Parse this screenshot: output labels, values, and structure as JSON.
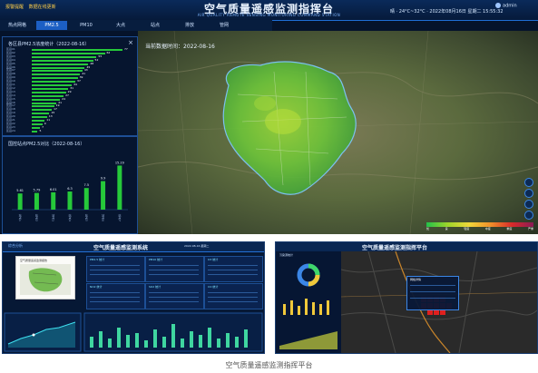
{
  "main": {
    "title": "空气质量遥感监测指挥台",
    "subtitle": "AIR QUALITY REMOTE SENSING MONITORING COMMAND STATION",
    "header_left": [
      "报警提醒",
      "数据在线更新"
    ],
    "header_right": "晴 · 24°C~32°C · 2022年08月16日 星期二 15:55:32",
    "user": "admin",
    "tabs": [
      "热点网格",
      "PM2.5",
      "PM10",
      "大点",
      "站点",
      "排放",
      "管网"
    ],
    "active_tab_index": 1,
    "map_label": "当前数据时间：2022-08-16",
    "ranking_panel": {
      "title": "各区县PM2.5浓度统计（2022-08-16）",
      "rows": [
        {
          "name": "区县01",
          "value": 77
        },
        {
          "name": "区县02",
          "value": 62
        },
        {
          "name": "区县03",
          "value": 55
        },
        {
          "name": "区县04",
          "value": 52
        },
        {
          "name": "区县05",
          "value": 48
        },
        {
          "name": "区县06",
          "value": 45
        },
        {
          "name": "区县07",
          "value": 43
        },
        {
          "name": "区县08",
          "value": 41
        },
        {
          "name": "区县09",
          "value": 39
        },
        {
          "name": "区县10",
          "value": 37
        },
        {
          "name": "区县11",
          "value": 34
        },
        {
          "name": "区县12",
          "value": 31
        },
        {
          "name": "区县13",
          "value": 29
        },
        {
          "name": "区县14",
          "value": 27
        },
        {
          "name": "区县15",
          "value": 24
        },
        {
          "name": "区县16",
          "value": 21
        },
        {
          "name": "区县17",
          "value": 19
        },
        {
          "name": "区县18",
          "value": 17
        },
        {
          "name": "区县19",
          "value": 15
        },
        {
          "name": "区县20",
          "value": 13
        },
        {
          "name": "区县21",
          "value": 11
        },
        {
          "name": "区县22",
          "value": 9
        },
        {
          "name": "区县23",
          "value": 7
        },
        {
          "name": "区县24",
          "value": 5
        }
      ]
    },
    "chart_panel": {
      "title": "国控站点PM2.5对比（2022-08-16）"
    },
    "legend_labels": [
      "优",
      "良",
      "轻度",
      "中度",
      "重度",
      "严重"
    ],
    "colors": {
      "accent": "#1c5fc4",
      "bar_green": "#26c93a",
      "header_bg": "#0a2a5a"
    }
  },
  "chart_data": {
    "type": "bar",
    "title": "国控站点PM2.5对比（2022-08-16）",
    "categories": [
      "站点1",
      "站点2",
      "站点3",
      "站点4",
      "站点5",
      "站点6",
      "站点7"
    ],
    "values": [
      5.61,
      5.79,
      6.01,
      6.3,
      7.5,
      9.9,
      15.29
    ],
    "ylim": [
      0,
      17
    ],
    "grid": false
  },
  "bottom_left": {
    "title": "空气质量遥感监测系统",
    "left_title": "综合分析",
    "header_right": "2022-08-16 星期二",
    "doc_title": "空气质量遥感监测报告",
    "card_titles": [
      "PM2.5 统计",
      "PM10 统计",
      "O3 统计",
      "NO2 统计",
      "SO2 统计",
      "CO 统计"
    ]
  },
  "bottom_right": {
    "title": "空气质量遥感监测指挥平台",
    "left_title": "污染源统计",
    "popup_title": "网格详情"
  },
  "caption": "空气质量遥感监测指挥平台"
}
